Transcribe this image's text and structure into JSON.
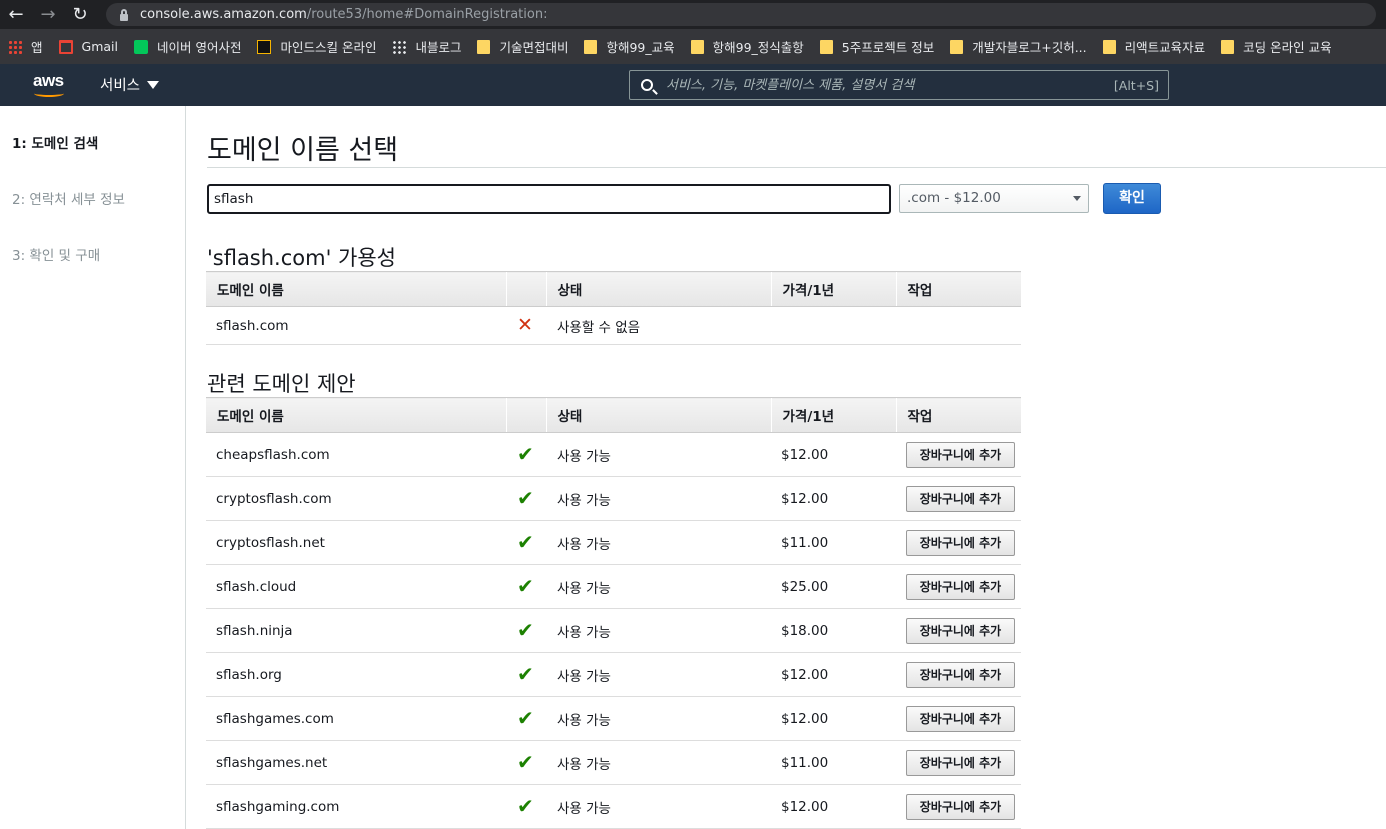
{
  "browser": {
    "url_host": "console.aws.amazon.com",
    "url_path": "/route53/home#DomainRegistration:",
    "bookmarks": [
      {
        "label": "앱",
        "icon": "apps-grid-icon"
      },
      {
        "label": "Gmail",
        "icon": "gmail-icon"
      },
      {
        "label": "네이버 영어사전",
        "icon": "naver-dict-icon"
      },
      {
        "label": "마인드스킬 온라인",
        "icon": "mindskill-icon"
      },
      {
        "label": "내블로그",
        "icon": "blog-icon"
      },
      {
        "label": "기술면접대비",
        "icon": "folder-icon"
      },
      {
        "label": "항해99_교육",
        "icon": "folder-icon"
      },
      {
        "label": "항해99_정식출항",
        "icon": "folder-icon"
      },
      {
        "label": "5주프로젝트 정보",
        "icon": "folder-icon"
      },
      {
        "label": "개발자블로그+깃허...",
        "icon": "folder-icon"
      },
      {
        "label": "리액트교육자료",
        "icon": "folder-icon"
      },
      {
        "label": "코딩 온라인 교육",
        "icon": "folder-icon"
      }
    ]
  },
  "aws_header": {
    "logo": "aws",
    "services_label": "서비스",
    "search_placeholder": "서비스, 기능, 마켓플레이스 제품, 설명서 검색",
    "search_shortcut": "[Alt+S]"
  },
  "steps": [
    {
      "label": "1: 도메인 검색",
      "active": true
    },
    {
      "label": "2: 연락처 세부 정보",
      "active": false
    },
    {
      "label": "3: 확인 및 구매",
      "active": false
    }
  ],
  "main": {
    "title": "도메인 이름 선택",
    "domain_input_value": "sflash",
    "tld_select_value": ".com - $12.00",
    "confirm_label": "확인"
  },
  "availability": {
    "heading": "'sflash.com' 가용성",
    "columns": [
      "도메인 이름",
      "",
      "상태",
      "가격/1년",
      "작업"
    ],
    "rows": [
      {
        "domain": "sflash.com",
        "available": false,
        "status": "사용할 수 없음",
        "price": "",
        "action": ""
      }
    ]
  },
  "suggestions": {
    "heading": "관련 도메인 제안",
    "columns": [
      "도메인 이름",
      "",
      "상태",
      "가격/1년",
      "작업"
    ],
    "add_to_cart_label": "장바구니에 추가",
    "rows": [
      {
        "domain": "cheapsflash.com",
        "available": true,
        "status": "사용 가능",
        "price": "$12.00"
      },
      {
        "domain": "cryptosflash.com",
        "available": true,
        "status": "사용 가능",
        "price": "$12.00"
      },
      {
        "domain": "cryptosflash.net",
        "available": true,
        "status": "사용 가능",
        "price": "$11.00"
      },
      {
        "domain": "sflash.cloud",
        "available": true,
        "status": "사용 가능",
        "price": "$25.00"
      },
      {
        "domain": "sflash.ninja",
        "available": true,
        "status": "사용 가능",
        "price": "$18.00"
      },
      {
        "domain": "sflash.org",
        "available": true,
        "status": "사용 가능",
        "price": "$12.00"
      },
      {
        "domain": "sflashgames.com",
        "available": true,
        "status": "사용 가능",
        "price": "$12.00"
      },
      {
        "domain": "sflashgames.net",
        "available": true,
        "status": "사용 가능",
        "price": "$11.00"
      },
      {
        "domain": "sflashgaming.com",
        "available": true,
        "status": "사용 가능",
        "price": "$12.00"
      }
    ]
  },
  "colors": {
    "aws_navy": "#232f3e",
    "aws_orange": "#ff9900",
    "available_green": "#1d8102",
    "unavailable_red": "#d13212",
    "primary_blue": "#1e66c6"
  }
}
